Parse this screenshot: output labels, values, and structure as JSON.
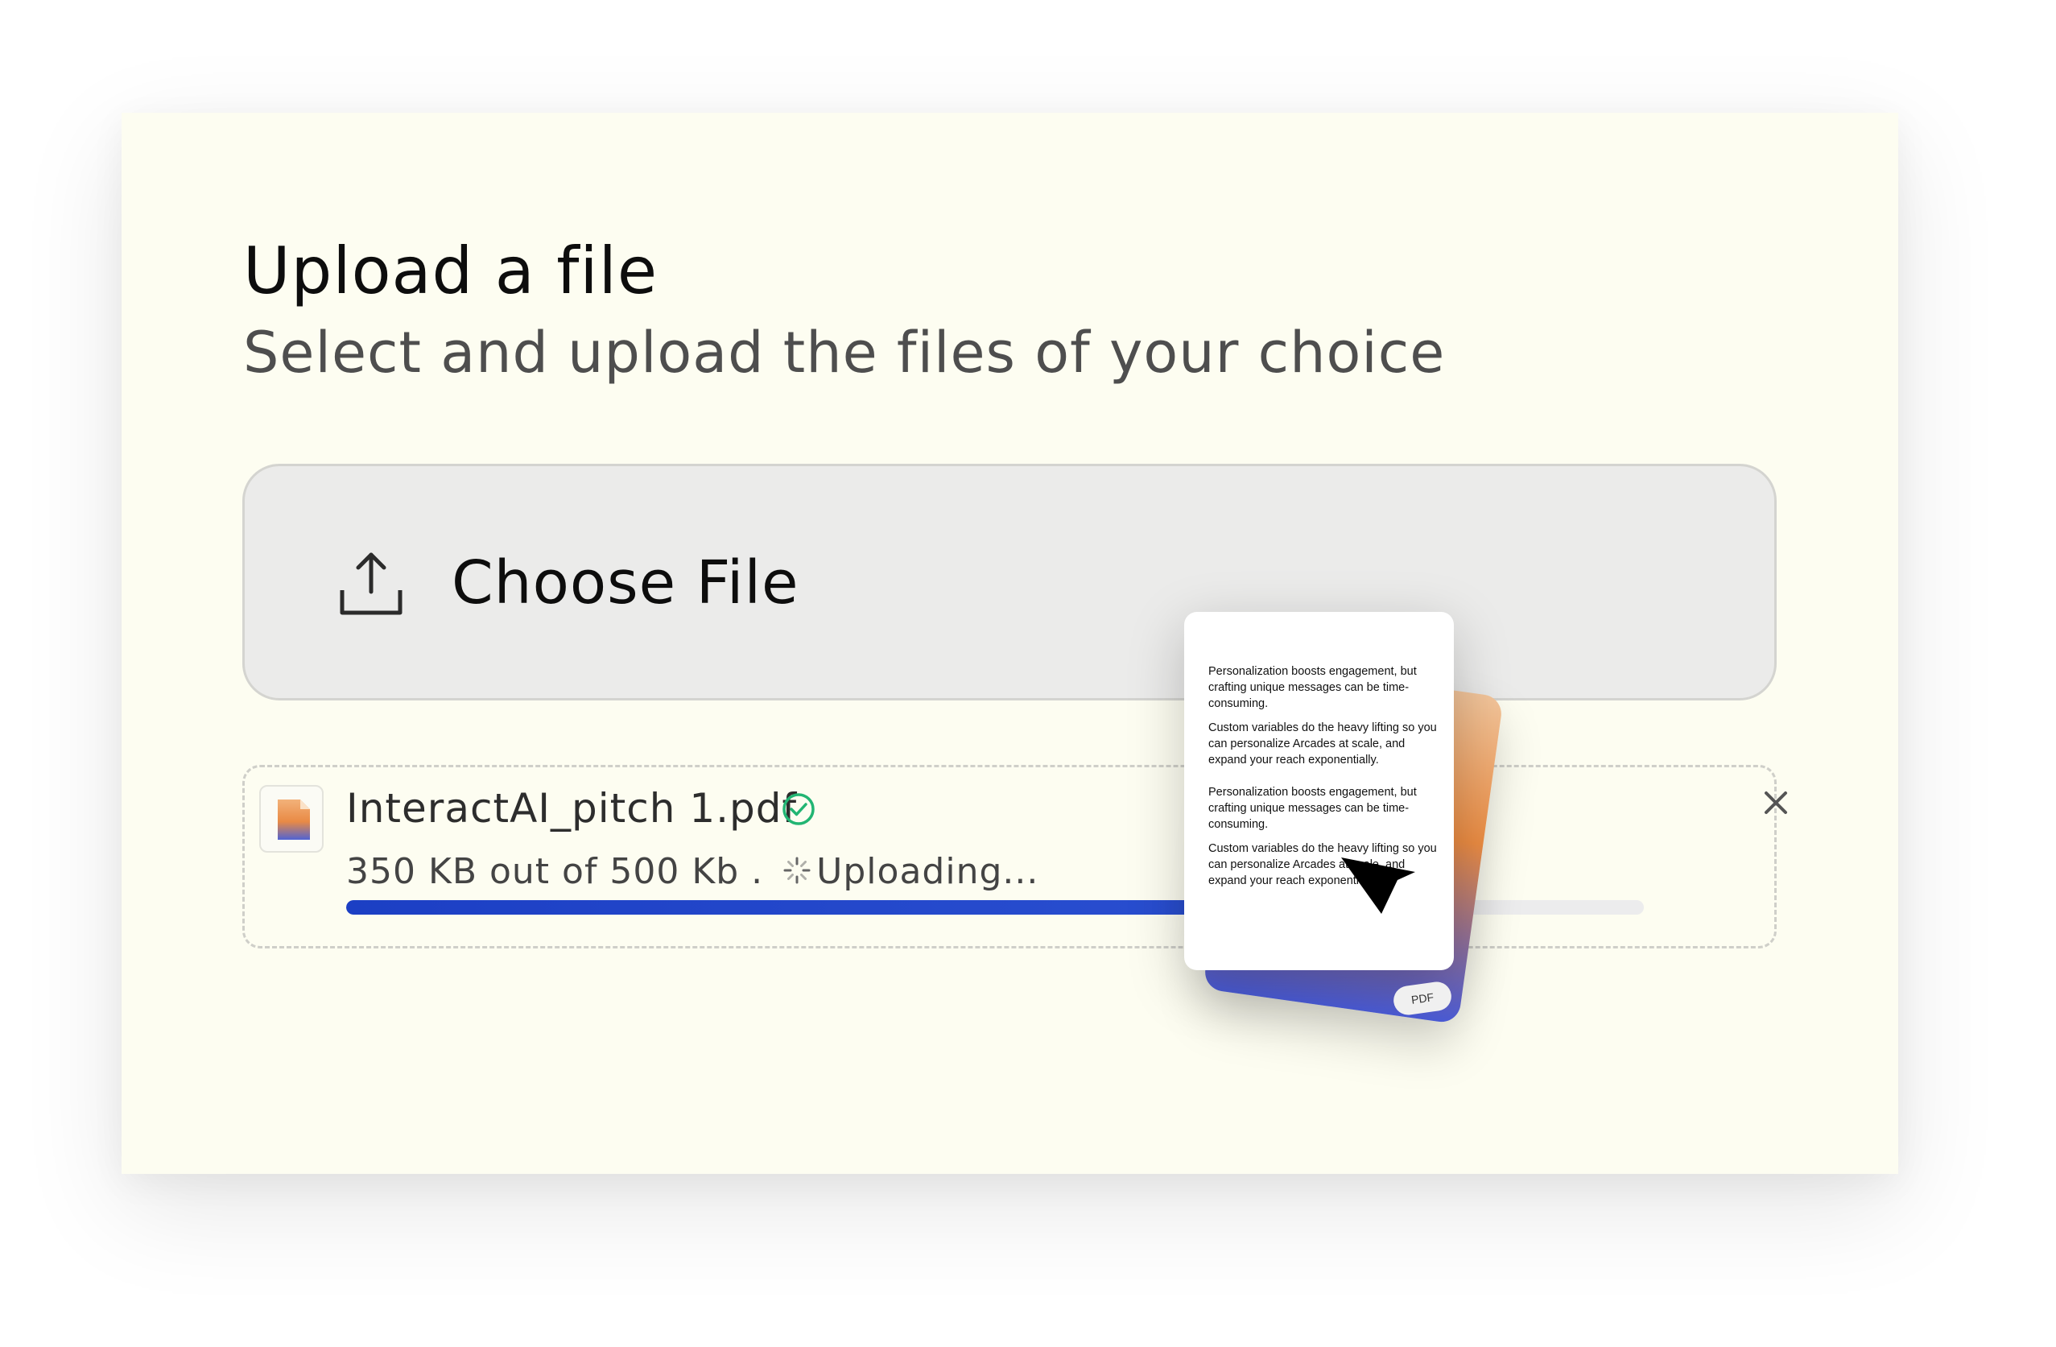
{
  "header": {
    "title": "Upload a file",
    "subtitle": "Select and upload the files of your choice"
  },
  "upload_button": {
    "label": "Choose File",
    "icon": "upload-icon"
  },
  "file_item": {
    "name": "InteractAI_pitch 1.pdf",
    "size_text": "350 KB out of 500 Kb .",
    "status_text": "Uploading...",
    "progress": 0.7,
    "status_icon": "check-circle-icon",
    "close_icon": "close-icon"
  },
  "preview": {
    "paragraphs": [
      "Personalization boosts engagement, but crafting unique messages can be time-consuming.",
      "Custom variables do the heavy lifting so you can personalize Arcades at scale, and expand your reach exponentially.",
      "Personalization boosts engagement, but crafting unique messages can be time-consuming.",
      "Custom variables do the heavy lifting so you can personalize Arcades at scale, and expand your reach exponentially."
    ],
    "badge": "PDF"
  },
  "colors": {
    "card_bg": "#fdfdf1",
    "progress": "#1c3fc4",
    "check": "#22b573"
  }
}
